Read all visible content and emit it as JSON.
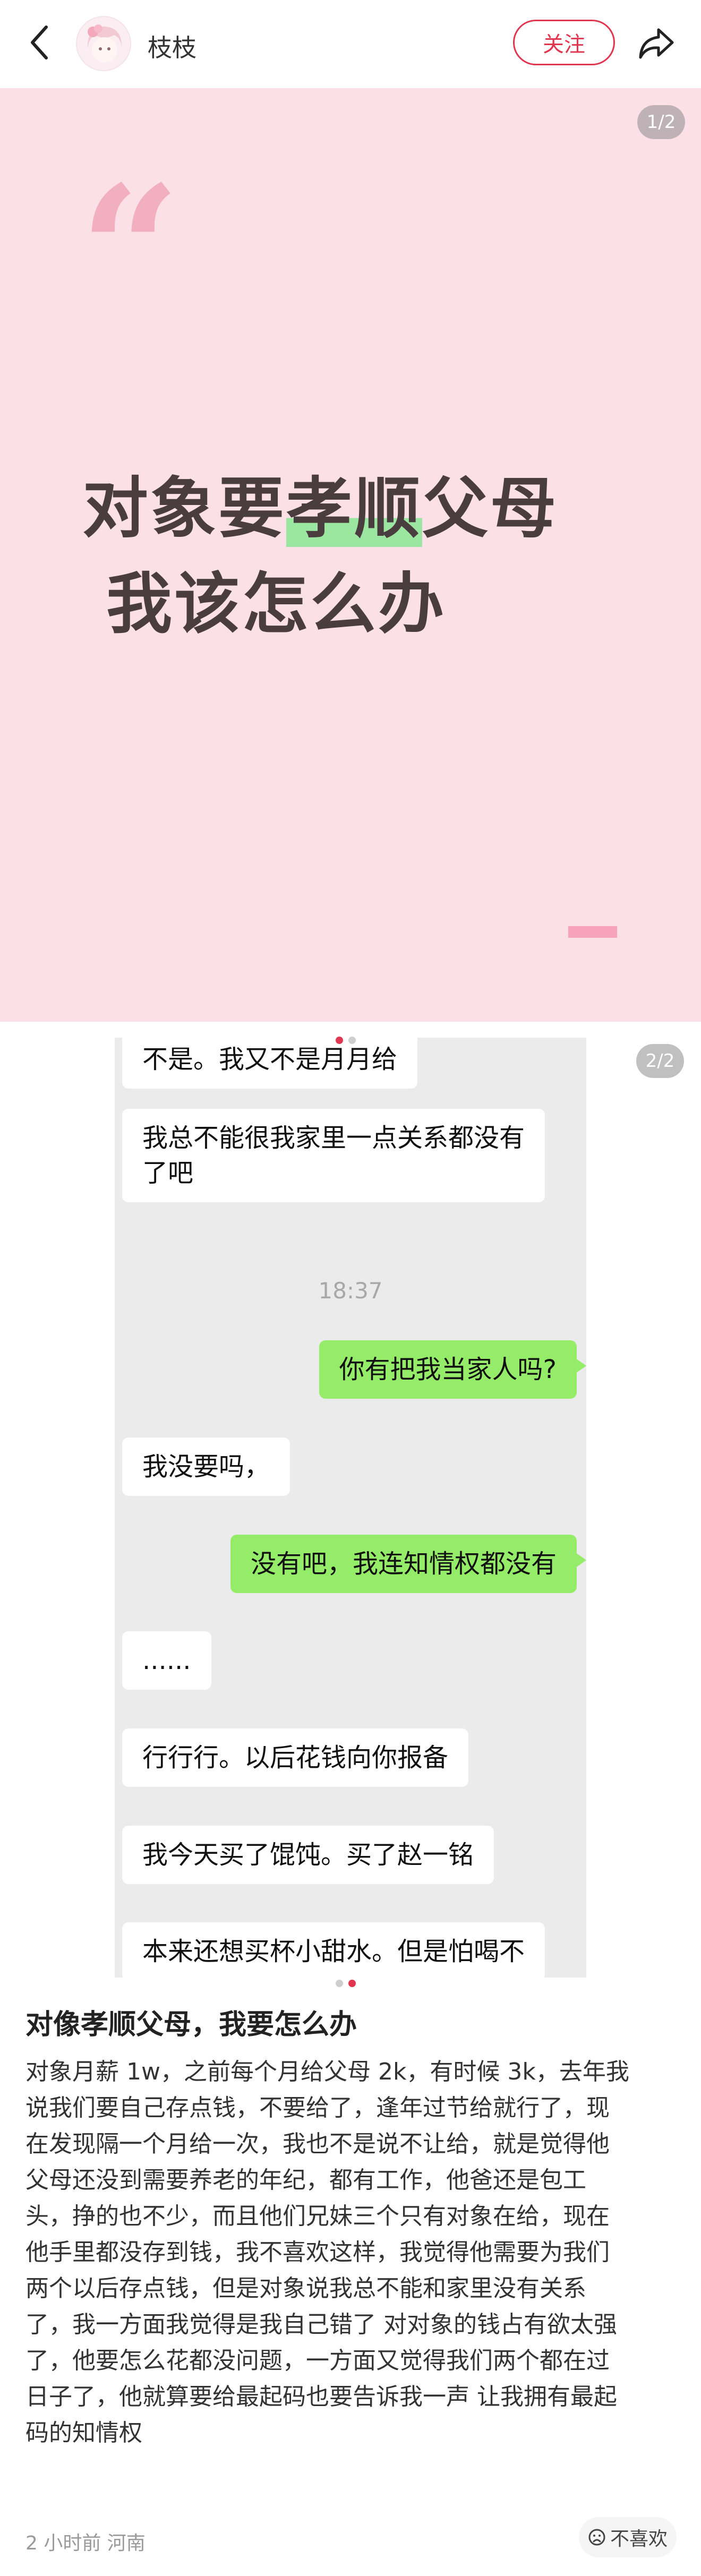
{
  "header": {
    "username": "枝枝",
    "follow_label": "关注"
  },
  "slide1": {
    "page_indicator": "1/2",
    "title_line1_before": "对象要",
    "title_line1_highlight": "孝顺",
    "title_line1_after": "父母",
    "title_line2": "我该怎么办"
  },
  "slide2": {
    "page_indicator": "2/2",
    "messages": [
      {
        "side": "in",
        "text": "不是。我又不是月月给"
      },
      {
        "side": "in",
        "text": "我总不能很我家里一点关系都没有\n了吧"
      },
      {
        "side": "time",
        "text": "18:37"
      },
      {
        "side": "out",
        "text": "你有把我当家人吗?"
      },
      {
        "side": "in",
        "text": "我没要吗，"
      },
      {
        "side": "out",
        "text": "没有吧，我连知情权都没有"
      },
      {
        "side": "in",
        "text": "......"
      },
      {
        "side": "in",
        "text": "行行行。以后花钱向你报备"
      },
      {
        "side": "in",
        "text": "我今天买了馄饨。买了赵一铭"
      },
      {
        "side": "in",
        "text": "本来还想买杯小甜水。但是怕喝不"
      }
    ]
  },
  "post": {
    "title": "对像孝顺父母，我要怎么办",
    "body_lines": [
      "对象月薪 1w，之前每个月给父母 2k，有时候 3k，去年我",
      "说我们要自己存点钱，不要给了，逢年过节给就行了，现",
      "在发现隔一个月给一次，我也不是说不让给，就是觉得他",
      "父母还没到需要养老的年纪，都有工作，他爸还是包工",
      "头，挣的也不少，而且他们兄妹三个只有对象在给，现在",
      "他手里都没存到钱，我不喜欢这样，我觉得他需要为我们",
      "两个以后存点钱，但是对象说我总不能和家里没有关系",
      "了，我一方面我觉得是我自己错了 对对象的钱占有欲太强",
      "了，他要怎么花都没问题，一方面又觉得我们两个都在过",
      "日子了，他就算要给最起码也要告诉我一声 让我拥有最起",
      "码的知情权"
    ],
    "meta": "2 小时前  河南",
    "dislike_label": "不喜欢"
  },
  "colors": {
    "accent": "#e0364f",
    "slide_bg": "#fce0e8",
    "highlight": "#9be6a0",
    "bubble_out": "#95ec69"
  }
}
